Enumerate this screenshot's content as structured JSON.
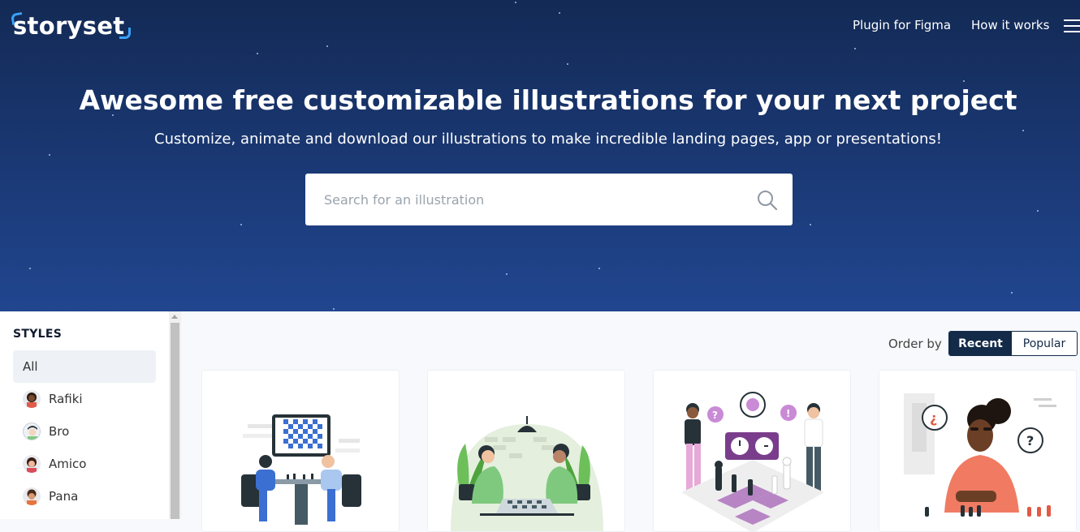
{
  "header": {
    "logo_text": "storyset",
    "nav": [
      "Plugin for Figma",
      "How it works"
    ]
  },
  "hero": {
    "headline": "Awesome free customizable illustrations for your next project",
    "subline": "Customize, animate and download our illustrations to make incredible landing pages, app or presentations!"
  },
  "search": {
    "placeholder": "Search for an illustration"
  },
  "sidebar": {
    "title": "STYLES",
    "items": [
      {
        "label": "All"
      },
      {
        "label": "Rafiki"
      },
      {
        "label": "Bro"
      },
      {
        "label": "Amico"
      },
      {
        "label": "Pana"
      }
    ]
  },
  "order": {
    "label": "Order by",
    "options": [
      "Recent",
      "Popular"
    ],
    "selected": "Recent"
  },
  "cards": [
    {
      "icon": "chess-players-table-illustration"
    },
    {
      "icon": "chess-players-plants-illustration"
    },
    {
      "icon": "chess-board-clock-illustration"
    },
    {
      "icon": "girl-thinking-chess-illustration"
    }
  ],
  "colors": {
    "hero_top": "#132a55",
    "hero_bottom": "#21468f",
    "accent": "#3aa3ff",
    "button_dark": "#132a48",
    "purple": "#7a3d8c"
  }
}
